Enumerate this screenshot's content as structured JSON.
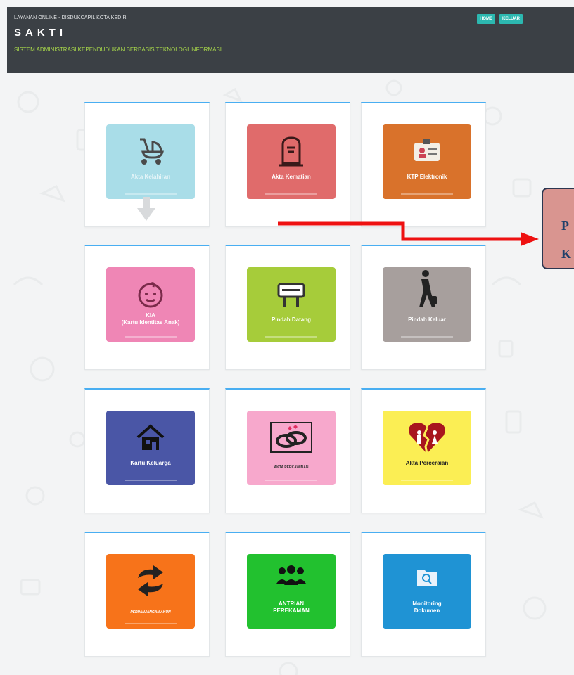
{
  "header": {
    "small_title": "LAYANAN ONLINE - DISDUKCAPIL KOTA KEDIRI",
    "app_name": "SAKTI",
    "subtitle": "SISTEM ADMINISTRASI KEPENDUDUKAN BERBASIS TEKNOLOGI INFORMASI",
    "nav": [
      {
        "label": "HOME"
      },
      {
        "label": "KELUAR"
      }
    ]
  },
  "services": [
    {
      "label": "Akta Kelahiran",
      "icon": "baby-stroller-icon",
      "color": "#a9dde8",
      "text_color": "#e6f5f8"
    },
    {
      "label": "Akta Kematian",
      "icon": "tombstone-icon",
      "color": "#e06b6b",
      "text_color": "#ffffff"
    },
    {
      "label": "KTP Elektronik",
      "icon": "id-card-icon",
      "color": "#d9722b",
      "text_color": "#ffffff"
    },
    {
      "label": "KIA\n(Kartu Identitas Anak)",
      "icon": "baby-face-icon",
      "color": "#ef86b5",
      "text_color": "#ffffff"
    },
    {
      "label": "Pindah Datang",
      "icon": "welcome-sign-icon",
      "color": "#a6cc3a",
      "text_color": "#ffffff"
    },
    {
      "label": "Pindah Keluar",
      "icon": "traveler-icon",
      "color": "#a79f9d",
      "text_color": "#ffffff"
    },
    {
      "label": "Kartu Keluarga",
      "icon": "house-icon",
      "color": "#4a56a6",
      "text_color": "#ffffff"
    },
    {
      "label": "AKTA PERKAWINAN",
      "icon": "wedding-rings-icon",
      "color": "#f7a8cc",
      "text_color": "#333333"
    },
    {
      "label": "Akta Perceraian",
      "icon": "broken-heart-icon",
      "color": "#fbee54",
      "text_color": "#222222"
    },
    {
      "label": "PERPANJANGAN AKUN",
      "icon": "sync-arrows-icon",
      "color": "#f7731a",
      "text_color": "#ffffff"
    },
    {
      "label": "ANTRIAN\nPEREKAMAN",
      "icon": "people-group-icon",
      "color": "#22c12f",
      "text_color": "#ffffff"
    },
    {
      "label": "Monitoring\nDokumen",
      "icon": "folder-search-icon",
      "color": "#1f93d4",
      "text_color": "#ffffff"
    }
  ],
  "callout": {
    "line1": "P",
    "line2": "K"
  },
  "colors": {
    "header_bg": "#3b4045",
    "accent_green": "#a8d84a",
    "button_teal": "#2cb8b0",
    "card_top_border": "#49aef2",
    "arrow_red": "#ee1111"
  }
}
